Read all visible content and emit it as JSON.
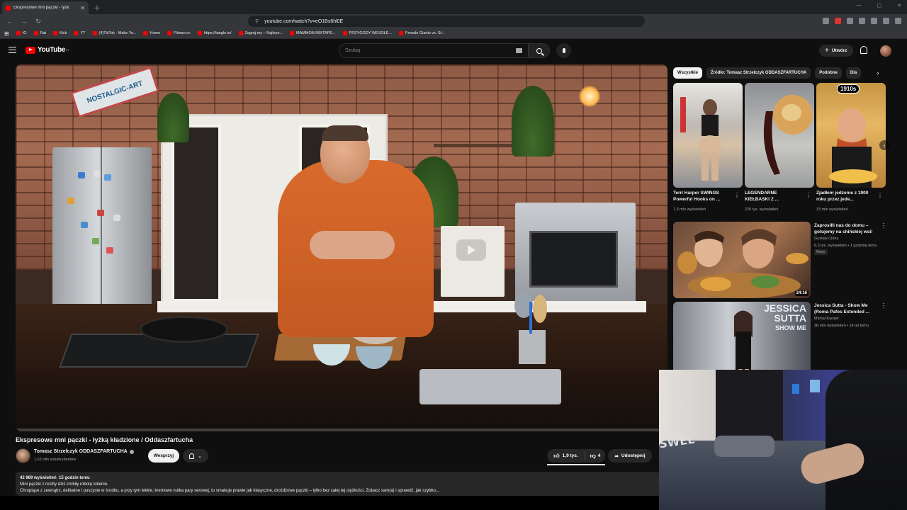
{
  "browser": {
    "tab_title": "Ekspresowe mni pączki - łyżk",
    "url": "youtube.com/watch?v=eO1Bs6hl0E",
    "bookmarks": [
      "IG",
      "Rat",
      "Kick",
      "YT",
      "(4)TikTok - Make Yo...",
      "Home",
      "Filman.cc",
      "https://tangle.io/",
      "Zagraj.my – Najleps...",
      "MAMMON MIXTAPE...",
      "PRZYGODY WESOŁE...",
      "Female Giants vs. St..."
    ]
  },
  "header": {
    "logo": "YouTube",
    "region": "PL",
    "search_placeholder": "Szukaj",
    "create_label": "Utwórz"
  },
  "video": {
    "progress": 0.0,
    "sign_text": "NOSTALGIC-ART",
    "title": "Ekspresowe mni pączki - łyżką kładzione / Oddaszfartucha",
    "channel": "Tomasz Strzelczyk ODDASZFARTUCHA",
    "subscribers": "1,62 mln subskrybentów",
    "join_label": "Wesprzyj",
    "likes": "1,9 tys.",
    "dislikes": "4",
    "share_label": "Udostępnij",
    "views": "42 969 wyświetleń",
    "published": "15 godzin temu",
    "desc_line1": "Mini pączki z ricotty dziś zrobiły robotę totalnie.",
    "desc_line2": "Chrupiące z zewnątrz, delikatne i puszyste w środku, a przy tym lekkie, kremowe nutka pary serowej, to smakuje prawie jak klasyczne, drożdżowe pączki – tylko bez całej tej ciężkości. Zobacz sam(a) i sprawdź, jak szybko..."
  },
  "sidebar": {
    "chips": [
      "Wszystkie",
      "Źródło: Tomasz Strzelczyk ODDASZFARTUCHA",
      "Podobne",
      "Dla"
    ],
    "shorts": [
      {
        "title": "Terri Harper SWINGS Powerful Hooks on ...",
        "views": "7,3 mln wyświetleń"
      },
      {
        "title": "LEGENDARNE KIEŁBASKI Z ...",
        "views": "225 tys. wyświetleń"
      },
      {
        "title": "Zjadłem jedzenie z 1900 roku przez jede...",
        "views": "33 mln wyświetleń",
        "badge": "1910s"
      }
    ],
    "recs": [
      {
        "title": "Zaprosiłli nas do domu – gotujemy na chińskiej wsi!",
        "channel": "Gustaw Chiny",
        "meta": "6,3 tys. wyświetleń • 1 godzinę temu",
        "badge": "Nowy",
        "duration": "24:16"
      },
      {
        "title": "Jessica Sutta - Show Me (Roma Pafos Extended ...",
        "channel": "Michał Kurpiel",
        "meta": "36 mln wyświetleń • 14 lat temu",
        "thumb_text_1": "JESSICA",
        "thumb_text_2": "SUTTA",
        "thumb_text_3": "SHOW ME"
      }
    ]
  },
  "webcam": {
    "overlay_text": "SWEL"
  },
  "colors": {
    "accent": "#ff0000",
    "background": "#0f0f0f",
    "chip_bg": "#272727"
  }
}
